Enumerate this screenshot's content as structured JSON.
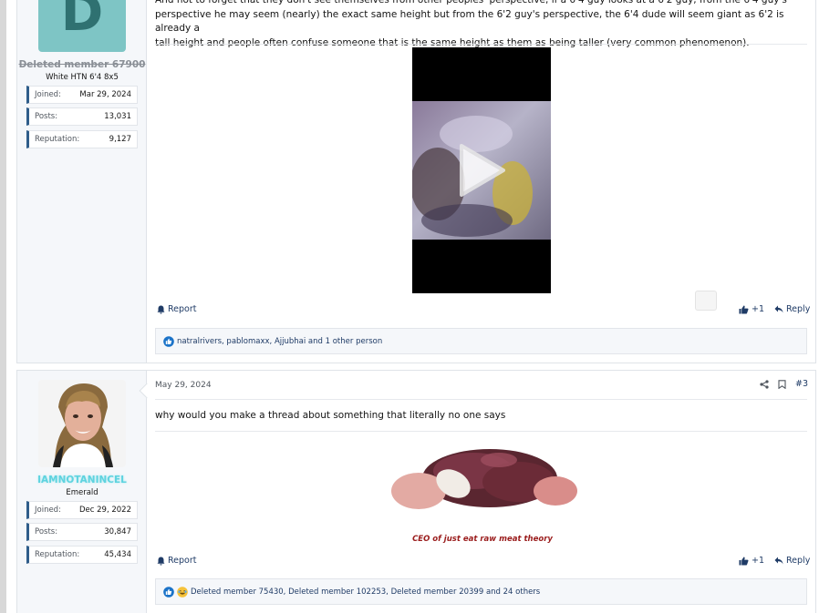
{
  "post1": {
    "user": {
      "avatar_letter": "D",
      "name": "Deleted member 67900",
      "title": "White HTN 6'4 8x5",
      "stats": [
        {
          "label": "Joined:",
          "value": "Mar 29, 2024"
        },
        {
          "label": "Posts:",
          "value": "13,031"
        },
        {
          "label": "Reputation:",
          "value": "9,127"
        }
      ]
    },
    "text_lines": [
      "And not to forget that they don't see themselves from other peoples' perspective, if a 6'4 guy looks at a 6'2 guy, from the 6'4 guy's",
      "perspective he may seem (nearly) the exact same height but from the 6'2 guy's perspective, the 6'4 dude will seem giant as 6'2 is already a",
      "tall height and people often confuse someone that is the same height as them as being taller (very common phenomenon)."
    ],
    "report_label": "Report",
    "like_label": "+1",
    "reply_label": "Reply",
    "reactions": "natralrivers, pablomaxx, Ajjubhai and 1 other person"
  },
  "post2": {
    "user": {
      "name": "IAMNOTANINCEL",
      "title": "Emerald",
      "stats": [
        {
          "label": "Joined:",
          "value": "Dec 29, 2022"
        },
        {
          "label": "Posts:",
          "value": "30,847"
        },
        {
          "label": "Reputation:",
          "value": "45,434"
        }
      ]
    },
    "date": "May 29, 2024",
    "post_number": "#3",
    "text": "why would you make a thread about something that literally no one says",
    "signature": "CEO of just eat raw meat theory",
    "report_label": "Report",
    "like_label": "+1",
    "reply_label": "Reply",
    "reactions": "Deleted member 75430, Deleted member 102253, Deleted member 20399 and 24 others"
  },
  "colors": {
    "link": "#1f3b66",
    "like_blue": "#1b73c8",
    "avatar_teal": "#7ec5c5",
    "username_cyan": "#5fd3df",
    "signature_red": "#9a1c1c"
  }
}
